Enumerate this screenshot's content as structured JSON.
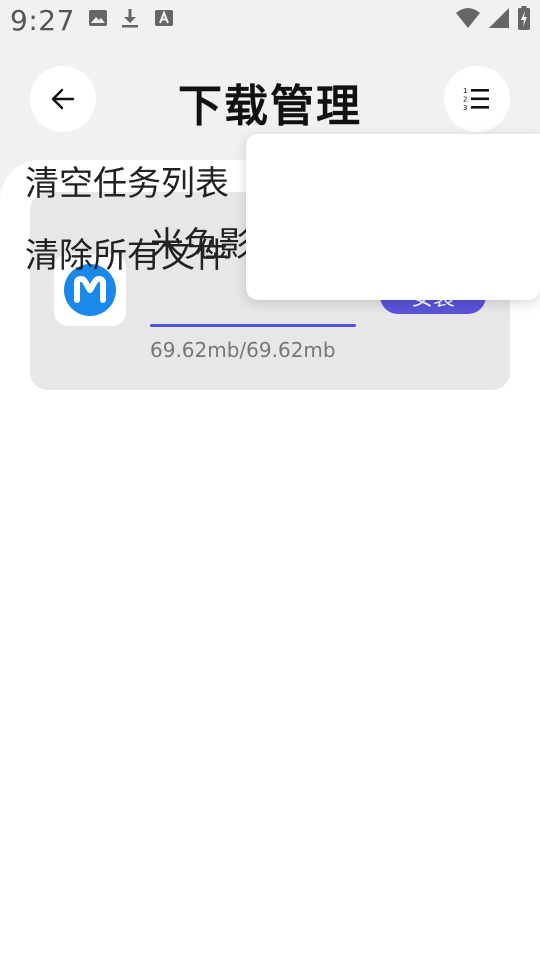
{
  "status_bar": {
    "time": "9:27",
    "left_icons": [
      "image-icon",
      "download-icon",
      "font-icon"
    ],
    "right_icons": [
      "wifi-icon",
      "signal-icon",
      "battery-charging-icon"
    ]
  },
  "header": {
    "title": "下载管理",
    "back_icon": "arrow-left-icon",
    "menu_icon": "numbered-list-icon"
  },
  "tasks": [
    {
      "file_name": "米兔影视.apk",
      "size_text": "69.62mb/69.62mb",
      "progress": 1.0,
      "icon": "mitu-app-icon",
      "action_label": "安装"
    }
  ],
  "popup_menu": {
    "items": [
      {
        "label": "清空任务列表"
      },
      {
        "label": "清除所有文件"
      }
    ]
  },
  "colors": {
    "accent": "#5a54db",
    "background": "#f1f1f3",
    "card": "#e7e7e9",
    "app_icon_blue": "#1a88e8"
  }
}
